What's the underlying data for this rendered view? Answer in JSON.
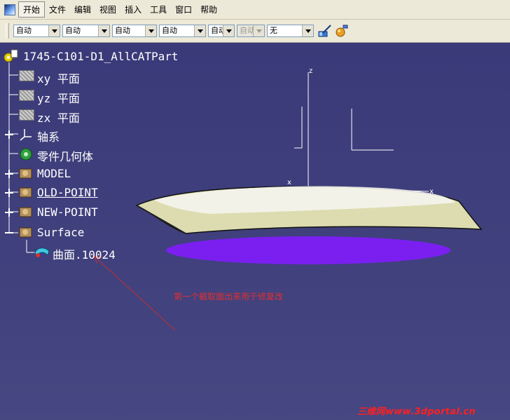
{
  "menu": {
    "items": [
      "开始",
      "文件",
      "编辑",
      "视图",
      "插入",
      "工具",
      "窗口",
      "帮助"
    ]
  },
  "toolbar": {
    "dropdowns": [
      "自动",
      "自动",
      "自动",
      "自动",
      "自动",
      "自动",
      "无"
    ],
    "disabled_index": 5
  },
  "tree": {
    "root": "1745-C101-D1_AllCATPart",
    "xy_plane": "xy 平面",
    "yz_plane": "yz 平面",
    "zx_plane": "zx 平面",
    "axis_system": "轴系",
    "part_body": "零件几何体",
    "model": "MODEL",
    "old_point": "OLD-POINT",
    "new_point": "NEW-POINT",
    "surface": "Surface",
    "surface_item": "曲面.10024"
  },
  "viewport": {
    "axis_z": "z",
    "axis_x1": "x",
    "axis_x2": "x"
  },
  "annotation": {
    "note": "第一个截取面出来用于修复改"
  },
  "watermark": {
    "text": "三维网www.3dportal.cn"
  },
  "colors": {
    "background": "#3b3b78",
    "surface_fill": "#dcdcb0",
    "ellipse": "#7a1ff0",
    "annotation": "#e03030"
  }
}
